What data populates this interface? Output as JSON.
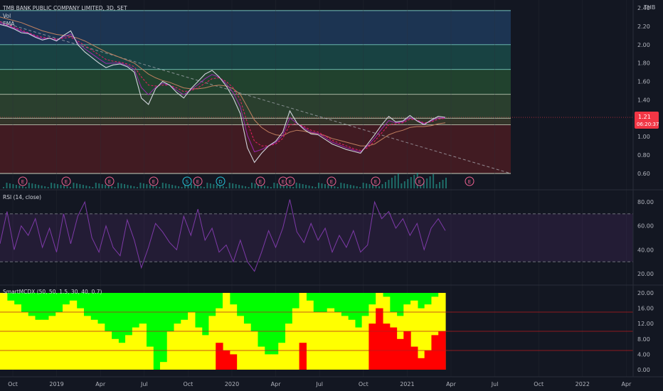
{
  "header": {
    "title": "TMB BANK PUBLIC COMPANY LIMITED, 3D, SET",
    "vol_label": "Vol",
    "ema_label": "EMA",
    "currency": "THB"
  },
  "price_badge": {
    "price": "1.21",
    "countdown": "06:20:37"
  },
  "rsi_label": "RSI (14, close)",
  "mcdx_label": "SmartMCDX (50, 50, 1.5, 30, 40, 0.7)",
  "colors": {
    "background": "#131722",
    "price_line": "#d1d4dc",
    "rsi_line": "#7e3aa8",
    "mcdx_green": "#00ff00",
    "mcdx_yellow": "#ffff00",
    "mcdx_red": "#ff0000",
    "badge": "#f23645"
  },
  "event_markers": [
    "E",
    "E",
    "E",
    "E",
    "S",
    "E",
    "D",
    "E",
    "E",
    "E",
    "E",
    "E",
    "E",
    "E"
  ],
  "chart_data": [
    {
      "type": "line",
      "name": "price",
      "x_tick_labels": [
        "Oct",
        "2019",
        "Apr",
        "Jul",
        "Oct",
        "2020",
        "Apr",
        "Jul",
        "Oct",
        "2021",
        "Apr",
        "Jul",
        "Oct",
        "2022",
        "Apr"
      ],
      "y_tick_labels": [
        "2.40",
        "2.20",
        "2.00",
        "1.80",
        "1.60",
        "1.40",
        "1.20",
        "1.00",
        "0.80",
        "0.60"
      ],
      "ylim": [
        0.6,
        2.4
      ],
      "zone_levels": [
        2.37,
        2.0,
        1.73,
        1.46,
        1.2,
        1.13,
        0.6
      ],
      "price": [
        2.22,
        2.2,
        2.17,
        2.13,
        2.12,
        2.08,
        2.05,
        2.07,
        2.04,
        2.1,
        2.15,
        2.0,
        1.92,
        1.86,
        1.8,
        1.75,
        1.78,
        1.79,
        1.76,
        1.7,
        1.42,
        1.35,
        1.52,
        1.6,
        1.56,
        1.48,
        1.42,
        1.52,
        1.6,
        1.68,
        1.72,
        1.65,
        1.55,
        1.42,
        1.25,
        0.88,
        0.72,
        0.82,
        0.9,
        0.95,
        1.05,
        1.28,
        1.15,
        1.08,
        1.03,
        1.02,
        0.97,
        0.92,
        0.89,
        0.86,
        0.84,
        0.82,
        0.92,
        1.02,
        1.13,
        1.22,
        1.16,
        1.17,
        1.23,
        1.17,
        1.13,
        1.18,
        1.22,
        1.21
      ],
      "ema_fast": [
        2.25,
        2.22,
        2.19,
        2.16,
        2.13,
        2.1,
        2.08,
        2.07,
        2.06,
        2.07,
        2.08,
        2.04,
        1.99,
        1.94,
        1.89,
        1.84,
        1.82,
        1.81,
        1.79,
        1.76,
        1.65,
        1.56,
        1.55,
        1.56,
        1.56,
        1.53,
        1.49,
        1.5,
        1.53,
        1.58,
        1.63,
        1.64,
        1.6,
        1.53,
        1.4,
        1.15,
        0.95,
        0.9,
        0.9,
        0.92,
        0.98,
        1.13,
        1.14,
        1.11,
        1.07,
        1.05,
        1.01,
        0.96,
        0.93,
        0.9,
        0.87,
        0.85,
        0.88,
        0.95,
        1.04,
        1.13,
        1.14,
        1.15,
        1.19,
        1.18,
        1.15,
        1.16,
        1.19,
        1.2
      ],
      "ema_slow": [
        2.3,
        2.28,
        2.26,
        2.24,
        2.21,
        2.18,
        2.15,
        2.13,
        2.11,
        2.1,
        2.09,
        2.07,
        2.04,
        2.0,
        1.96,
        1.92,
        1.89,
        1.86,
        1.83,
        1.8,
        1.74,
        1.68,
        1.64,
        1.61,
        1.59,
        1.56,
        1.53,
        1.52,
        1.52,
        1.53,
        1.55,
        1.56,
        1.55,
        1.52,
        1.46,
        1.32,
        1.18,
        1.1,
        1.05,
        1.02,
        1.01,
        1.05,
        1.07,
        1.06,
        1.04,
        1.03,
        1.01,
        0.98,
        0.96,
        0.94,
        0.92,
        0.9,
        0.9,
        0.92,
        0.97,
        1.02,
        1.05,
        1.07,
        1.1,
        1.11,
        1.11,
        1.12,
        1.14,
        1.15
      ],
      "trend_line": {
        "start": 2.25,
        "end": 0.6
      }
    },
    {
      "type": "line",
      "name": "RSI (14, close)",
      "y_tick_labels": [
        "80.00",
        "60.00",
        "40.00",
        "20.00"
      ],
      "ylim": [
        10,
        88
      ],
      "bands": [
        70,
        30
      ],
      "values": [
        45,
        72,
        40,
        60,
        52,
        66,
        42,
        58,
        38,
        70,
        45,
        68,
        80,
        50,
        38,
        60,
        42,
        35,
        65,
        48,
        25,
        42,
        62,
        55,
        46,
        40,
        68,
        52,
        74,
        48,
        58,
        38,
        44,
        30,
        48,
        30,
        22,
        38,
        56,
        42,
        58,
        82,
        55,
        46,
        62,
        48,
        58,
        38,
        52,
        42,
        56,
        38,
        44,
        80,
        66,
        72,
        58,
        66,
        52,
        62,
        40,
        58,
        66,
        56
      ]
    },
    {
      "type": "area",
      "name": "SmartMCDX",
      "y_tick_labels": [
        "20.00",
        "16.00",
        "12.00",
        "8.00",
        "4.00",
        "0.00"
      ],
      "ylim": [
        0,
        20
      ],
      "levels": [
        15,
        10,
        5
      ],
      "yellow": [
        20,
        18,
        17,
        15,
        14,
        13,
        13,
        14,
        15,
        17,
        18,
        16,
        14,
        13,
        12,
        10,
        8,
        7,
        9,
        11,
        12,
        6,
        0,
        2,
        10,
        12,
        13,
        15,
        11,
        9,
        14,
        16,
        20,
        17,
        14,
        12,
        10,
        6,
        4,
        4,
        7,
        12,
        16,
        20,
        18,
        15,
        15,
        16,
        15,
        14,
        13,
        11,
        14,
        17,
        20,
        19,
        15,
        14,
        17,
        18,
        16,
        17,
        19,
        20
      ],
      "red": [
        0,
        0,
        0,
        0,
        0,
        0,
        0,
        0,
        0,
        0,
        0,
        0,
        0,
        0,
        0,
        0,
        0,
        0,
        0,
        0,
        0,
        0,
        0,
        0,
        0,
        0,
        0,
        0,
        0,
        0,
        0,
        7,
        5,
        4,
        0,
        0,
        0,
        0,
        0,
        0,
        0,
        0,
        0,
        7,
        0,
        0,
        0,
        0,
        0,
        0,
        0,
        0,
        0,
        12,
        16,
        12,
        11,
        8,
        10,
        6,
        3,
        5,
        9,
        10
      ]
    }
  ]
}
